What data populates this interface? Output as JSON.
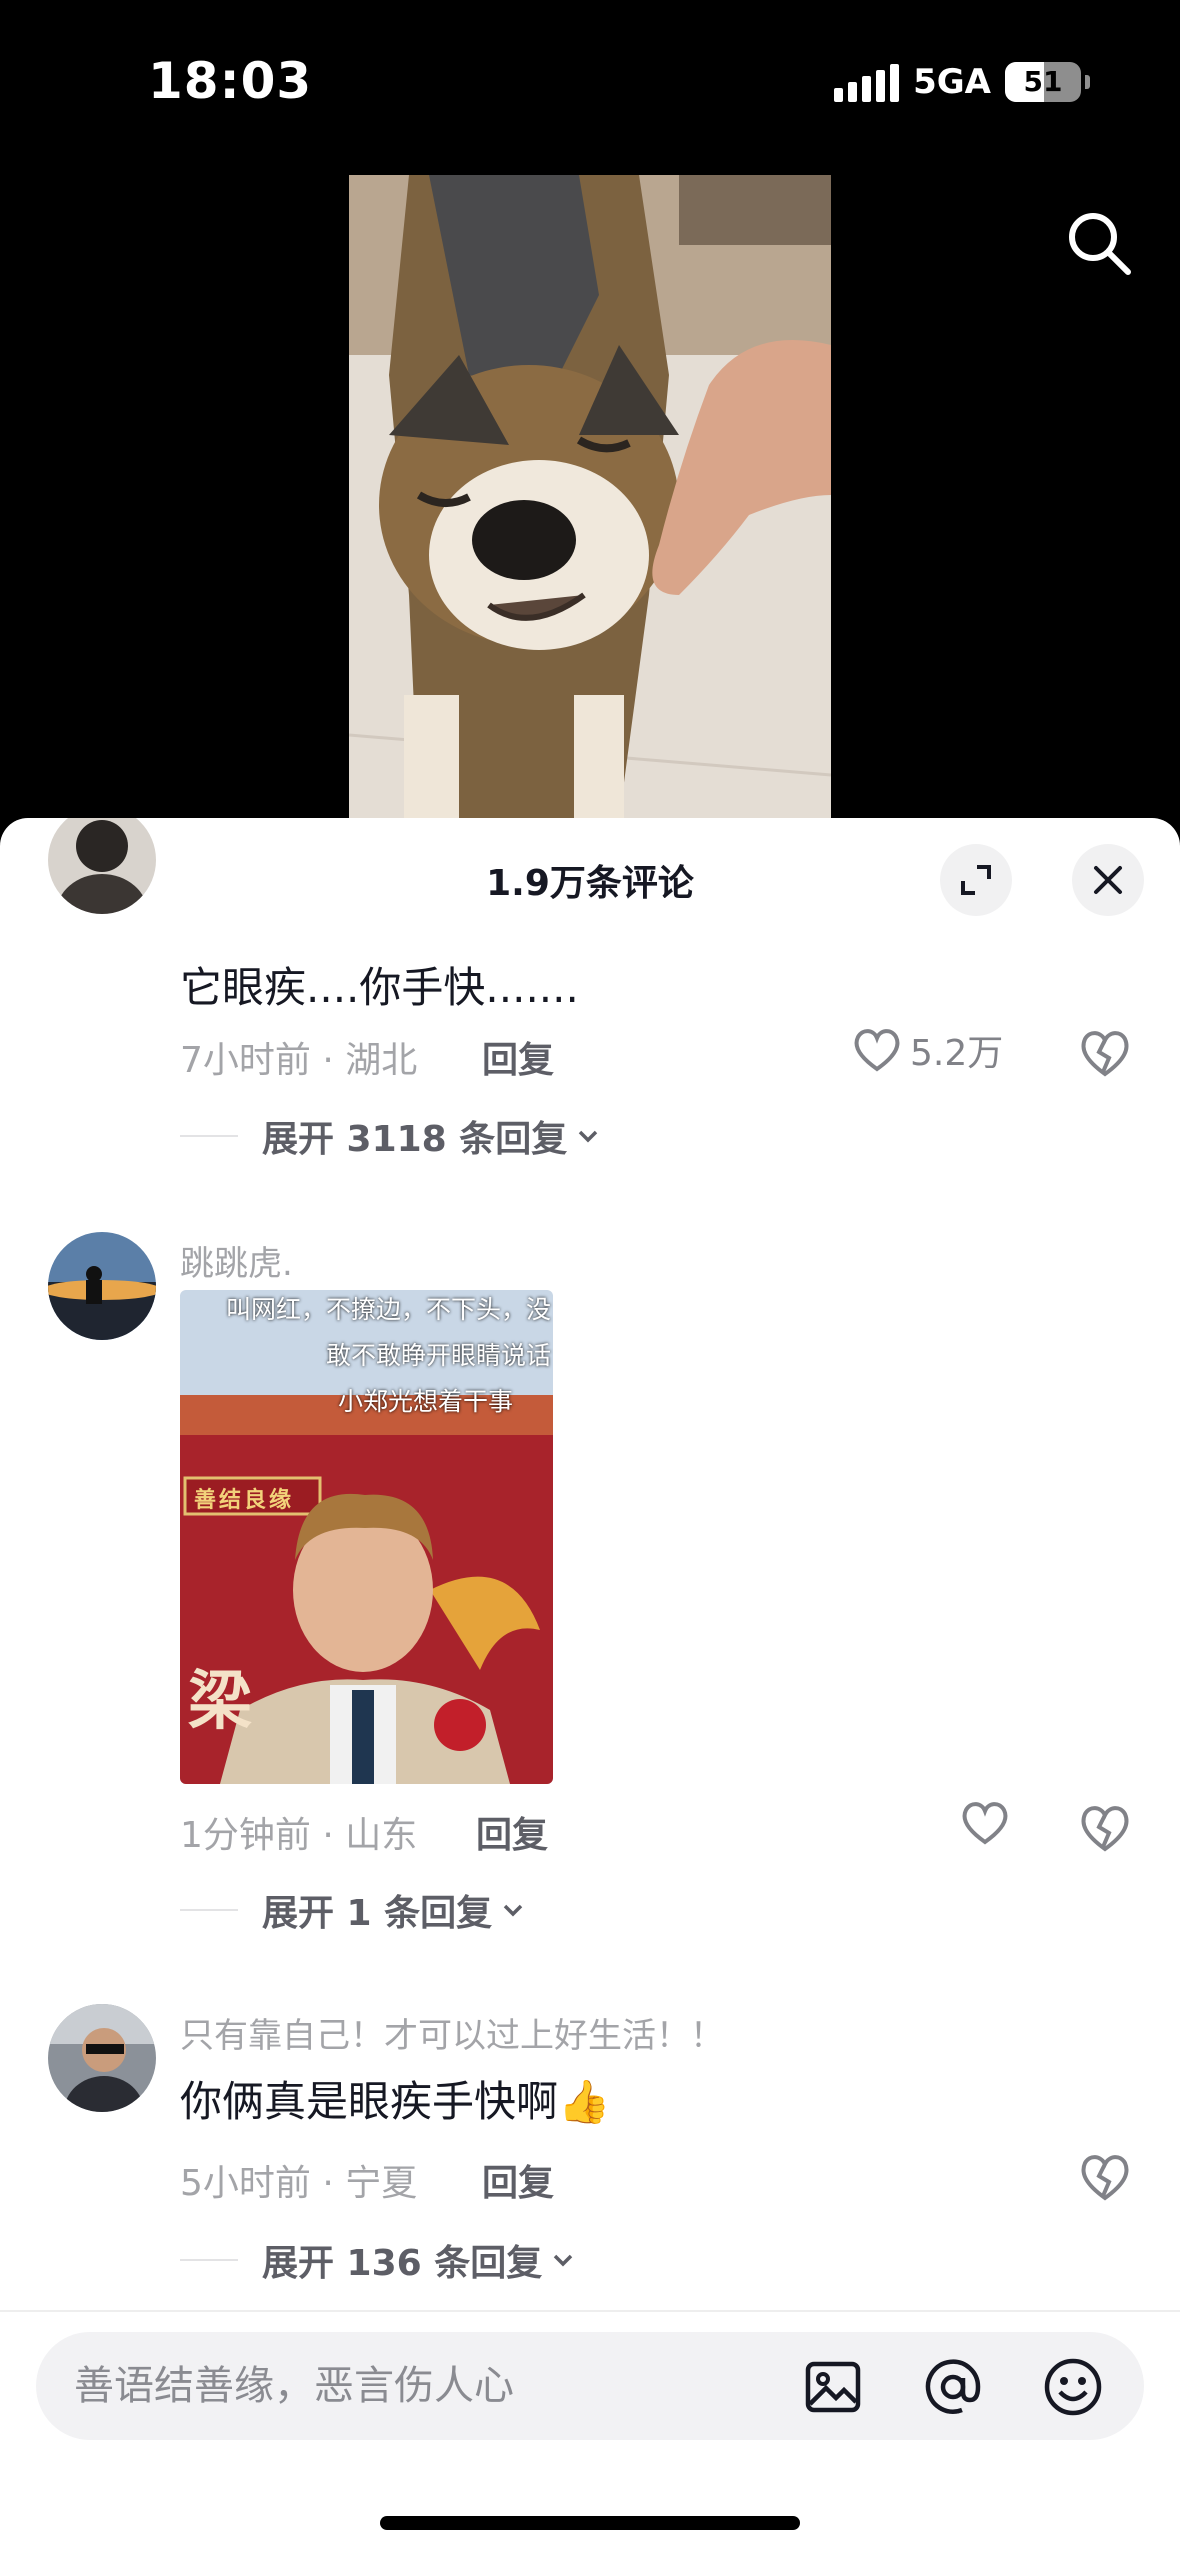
{
  "status_bar": {
    "time": "18:03",
    "network": "5GA",
    "battery": "51"
  },
  "sheet": {
    "title": "1.9万条评论"
  },
  "comments": [
    {
      "text": "它眼疾....你手快.......",
      "time_location": "7小时前 · 湖北",
      "reply_label": "回复",
      "likes": "5.2万",
      "expand_label": "展开 3118 条回复"
    },
    {
      "username": "跳跳虎.",
      "image_caption": [
        "叫网红，不撩边，不下头，没",
        "敢不敢睁开眼睛说话",
        "小郑光想着干事"
      ],
      "image_sign": "善结良缘",
      "image_big_char": "梁",
      "time_location": "1分钟前 · 山东",
      "reply_label": "回复",
      "expand_label": "展开 1 条回复"
    },
    {
      "username": "只有靠自己！才可以过上好生活！！",
      "text": "你俩真是眼疾手快啊",
      "emoji": "👍",
      "time_location": "5小时前 · 宁夏",
      "reply_label": "回复",
      "expand_label": "展开 136 条回复"
    }
  ],
  "input": {
    "placeholder": "善语结善缘，恶言伤人心"
  }
}
